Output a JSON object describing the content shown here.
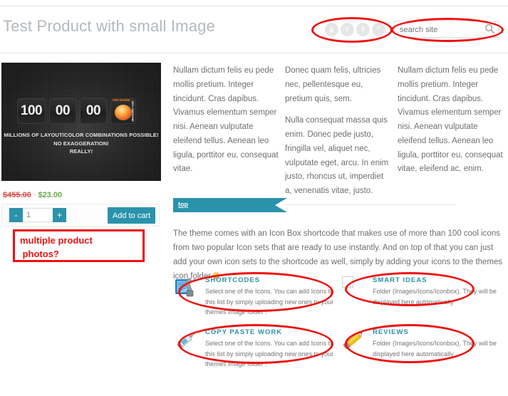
{
  "header": {
    "title": "Test Product with small Image",
    "social": [
      {
        "name": "googleplus-icon",
        "glyph": "g"
      },
      {
        "name": "twitter-icon",
        "glyph": "t"
      },
      {
        "name": "facebook-icon",
        "glyph": "f"
      },
      {
        "name": "rss-icon",
        "glyph": "◜"
      }
    ],
    "search": {
      "placeholder": "search site",
      "value": ""
    }
  },
  "product": {
    "image": {
      "counters": [
        "100",
        "00",
        "00"
      ],
      "ball_label_left": "FIRE SPHERE",
      "ball_label_right": "100% AWESOME",
      "caption_line1": "MILLIONS OF LAYOUT/COLOR COMBINATIONS POSSIBLE!",
      "caption_line2": "NO EXAGGERATION!",
      "caption_line3": "REALLY!"
    },
    "price_old": "$455.00",
    "price_separator": "·",
    "price_new": "$23.00",
    "quantity": {
      "decrement_label": "-",
      "value": "1",
      "increment_label": "+"
    },
    "add_to_cart_label": "Add to cart"
  },
  "columns": [
    {
      "paragraphs": [
        "Nullam dictum felis eu pede mollis pretium. Integer tincidunt. Cras dapibus. Vivamus elementum semper nisi. Aenean vulputate eleifend tellus. Aenean leo ligula, porttitor eu, consequat vitae."
      ]
    },
    {
      "paragraphs": [
        "Donec quam felis, ultricies nec, pellentesque eu, pretium quis, sem.",
        "Nulla consequat massa quis enim. Donec pede justo, fringilla vel, aliquet nec, vulputate eget, arcu. In enim justo, rhoncus ut, imperdiet a, venenatis vitae, justo."
      ]
    },
    {
      "paragraphs": [
        "Nullam dictum felis eu pede mollis pretium. Integer tincidunt. Cras dapibus. Vivamus elementum semper nisi. Aenean vulputate eleifend tellus. Aenean leo ligula, porttitor eu, consequat vitae, eleifend ac, enim."
      ]
    }
  ],
  "ribbon": {
    "label": "top"
  },
  "intro": {
    "text": "The theme comes with an Icon Box shortcode that makes use of more than 100 cool icons from two popular Icon sets that are ready to use instantly. And on top of that you can just add your own icon sets to the shortcode as well, simply by adding your icons to the themes icon folder"
  },
  "icon_boxes": [
    {
      "icon": "wrench-settings-icon",
      "title": "SHORTCODES",
      "desc": "Select one of the Icons. You can add Icons to this list by simply uploading new ones to your themes image folder ."
    },
    {
      "icon": "broken-image-icon",
      "title": "SMART IDEAS",
      "desc": "Folder (Images/Icons/Iconbox). They will be displayed here automatically"
    },
    {
      "icon": "syringe-icon",
      "title": "COPY PASTE WORK",
      "desc": "Select one of the Icons. You can add Icons to this list by simply uploading new ones to your themes image folder ."
    },
    {
      "icon": "pencil-icon",
      "title": "REVIEWS",
      "desc": "Folder (Images/Icons/Iconbox). They will be displayed here automatically"
    }
  ],
  "annotations": {
    "note_box_text": "multiple product\n photos?"
  },
  "colors": {
    "accent_teal": "#2a93ab",
    "annotation_red": "#ee1111",
    "price_old": "#d8504a",
    "price_new": "#6aa84f"
  }
}
